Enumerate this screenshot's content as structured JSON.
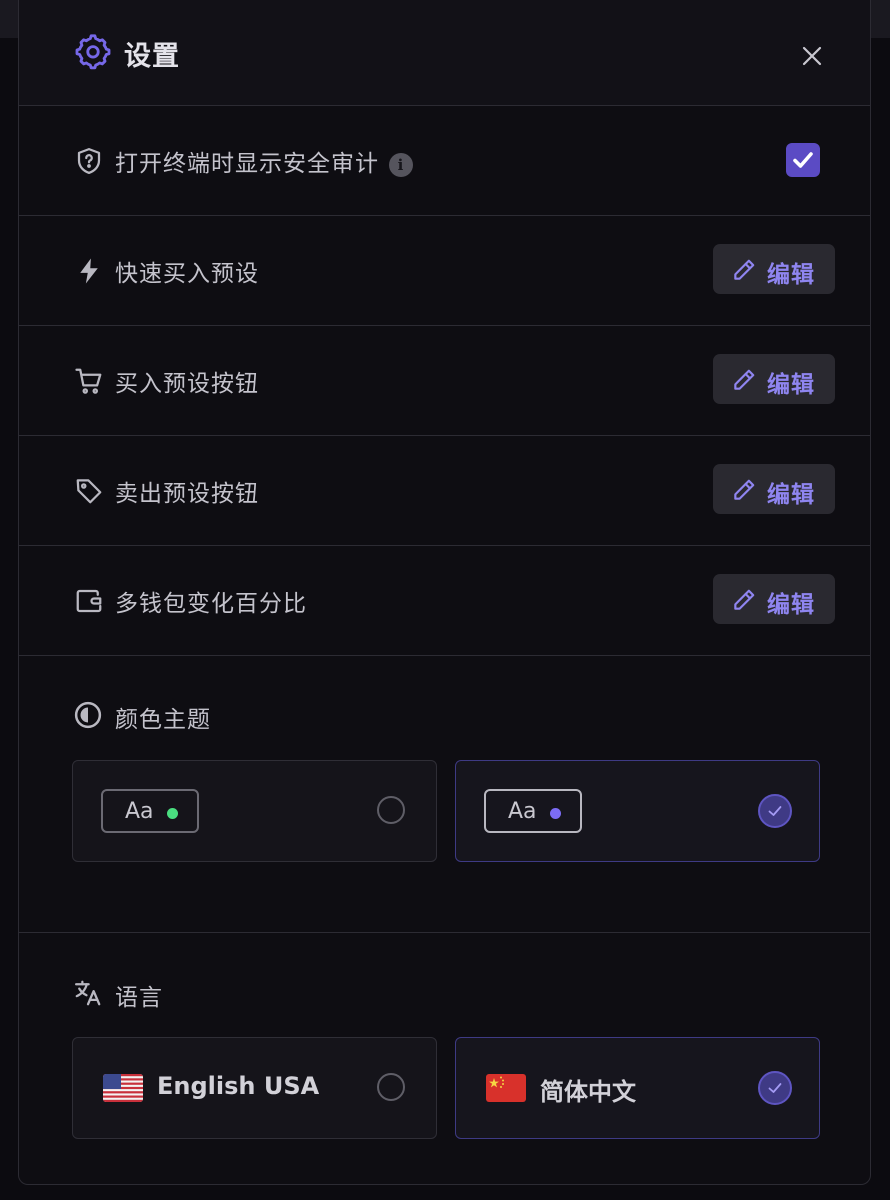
{
  "header": {
    "title": "设置",
    "icon": "gear-icon"
  },
  "settings": {
    "audit": {
      "label": "打开终端时显示安全审计",
      "info": "i",
      "checked": true
    },
    "rows": [
      {
        "label": "快速买入预设",
        "icon": "lightning-icon",
        "button": "编辑"
      },
      {
        "label": "买入预设按钮",
        "icon": "cart-icon",
        "button": "编辑"
      },
      {
        "label": "卖出预设按钮",
        "icon": "tag-icon",
        "button": "编辑"
      },
      {
        "label": "多钱包变化百分比",
        "icon": "wallet-icon",
        "button": "编辑"
      }
    ]
  },
  "theme": {
    "title": "颜色主题",
    "options": [
      {
        "text": "Aa",
        "dot_color": "#4ade80",
        "selected": false
      },
      {
        "text": "Aa",
        "dot_color": "#7c6cf5",
        "selected": true
      }
    ]
  },
  "language": {
    "title": "语言",
    "options": [
      {
        "label": "English USA",
        "flag": "us-flag",
        "selected": false
      },
      {
        "label": "简体中文",
        "flag": "cn-flag",
        "selected": true
      }
    ]
  },
  "colors": {
    "accent": "#5b4bc4",
    "edit_text": "#8f85f0",
    "panel_bg": "#0e0d12"
  }
}
